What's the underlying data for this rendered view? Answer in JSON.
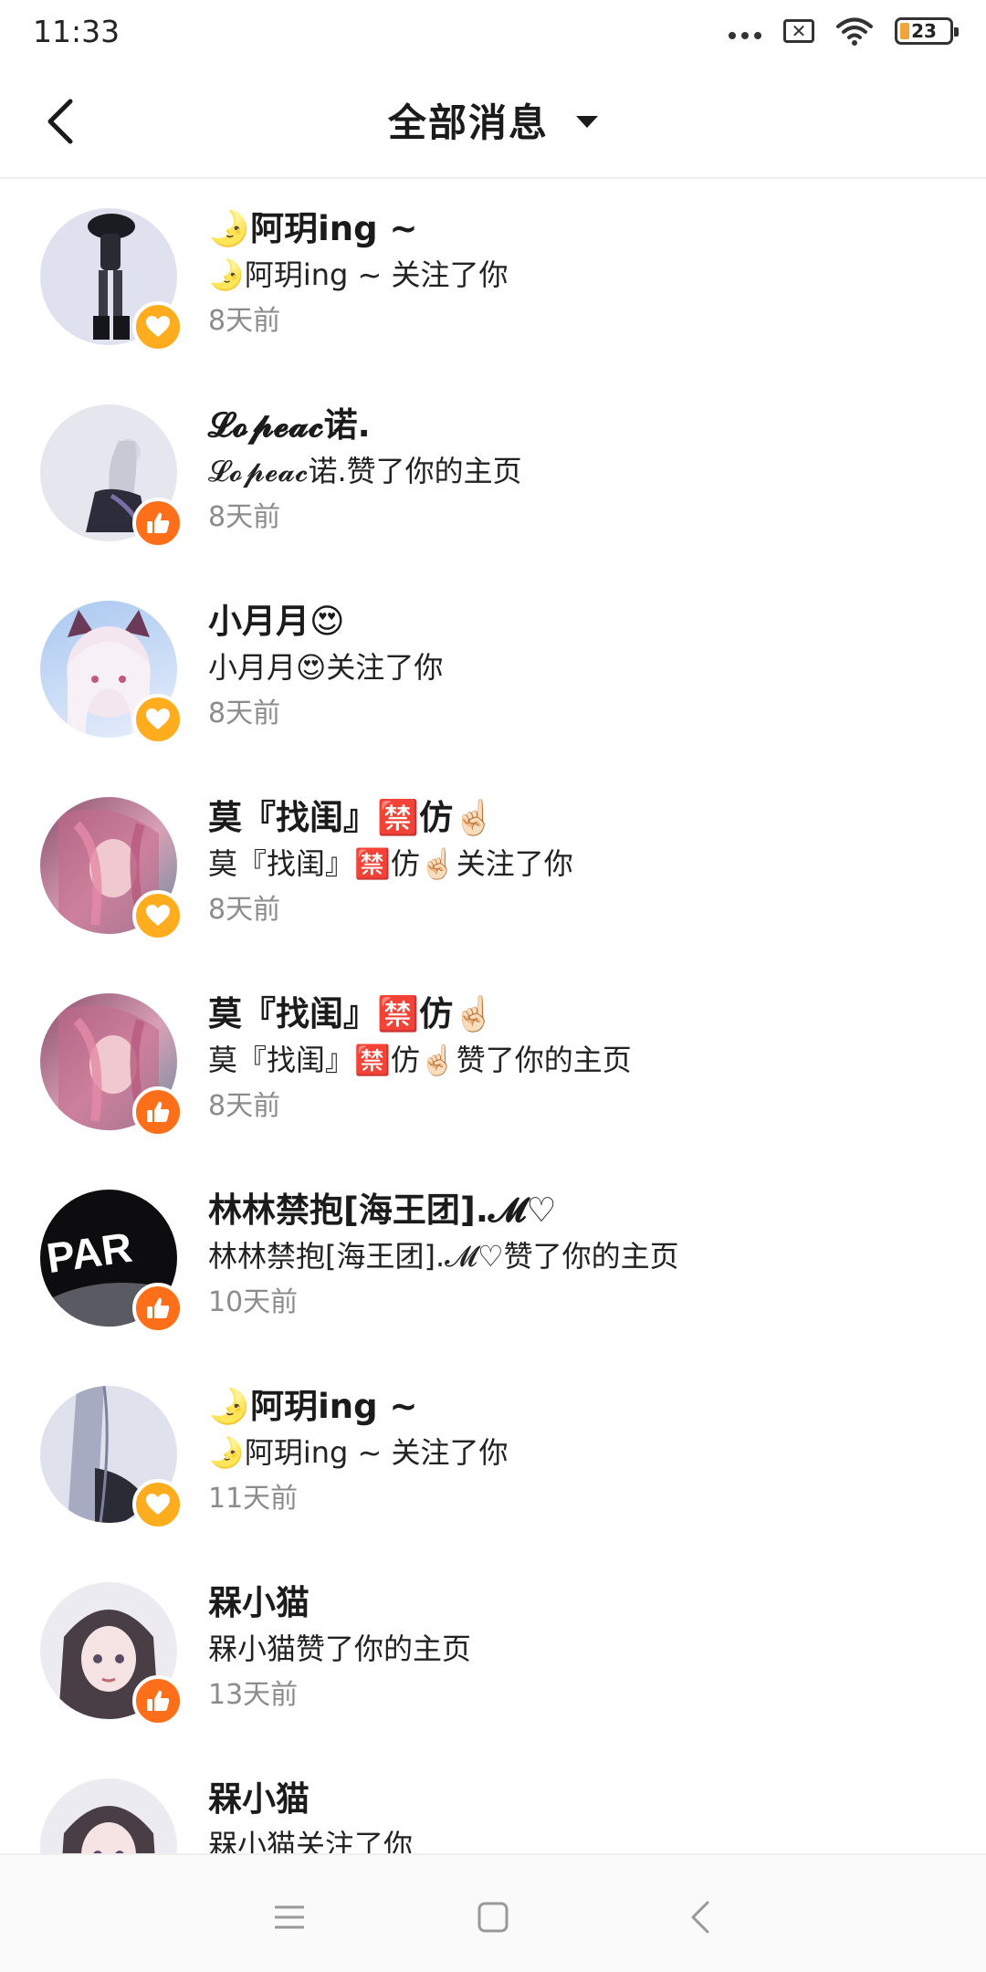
{
  "status_bar": {
    "time": "11:33",
    "battery_level": "23",
    "icons": [
      "more-dots-icon",
      "sim-off-icon",
      "wifi-icon",
      "battery-icon"
    ]
  },
  "header": {
    "title": "全部消息",
    "back_icon": "back-arrow-icon",
    "dropdown_icon": "caret-down-icon"
  },
  "notifications": [
    {
      "name": "🌛阿玥ing ~",
      "message": "🌛阿玥ing ~ 关注了你",
      "time": "8天前",
      "badge": "heart-icon"
    },
    {
      "name": "𝓛𝓸𝓹𝓮𝓪𝓬诺.",
      "message": "𝓛𝓸𝓹𝓮𝓪𝓬诺.赞了你的主页",
      "time": "8天前",
      "badge": "thumbs-up-icon"
    },
    {
      "name": "小月月😍",
      "message": "小月月😍关注了你",
      "time": "8天前",
      "badge": "heart-icon"
    },
    {
      "name": "莫『找闺』🈲仿☝🏻",
      "message": "莫『找闺』🈲仿☝🏻关注了你",
      "time": "8天前",
      "badge": "heart-icon"
    },
    {
      "name": "莫『找闺』🈲仿☝🏻",
      "message": "莫『找闺』🈲仿☝🏻赞了你的主页",
      "time": "8天前",
      "badge": "thumbs-up-icon"
    },
    {
      "name": "林林禁抱[海王团].𝓜♡",
      "message": "林林禁抱[海王团].𝓜♡赞了你的主页",
      "time": "10天前",
      "badge": "thumbs-up-icon"
    },
    {
      "name": "🌛阿玥ing ~",
      "message": "🌛阿玥ing ~ 关注了你",
      "time": "11天前",
      "badge": "heart-icon"
    },
    {
      "name": "槑小猫",
      "message": "槑小猫赞了你的主页",
      "time": "13天前",
      "badge": "thumbs-up-icon"
    },
    {
      "name": "槑小猫",
      "message": "槑小猫关注了你",
      "time": "",
      "badge": ""
    }
  ],
  "bottom_nav": {
    "icons": [
      "menu-icon",
      "home-square-icon",
      "back-chevron-icon"
    ]
  },
  "colors": {
    "heart_badge": "#ffad1f",
    "thumb_badge": "#ff6f19",
    "time_text": "#8c8c8c",
    "divider": "#eeeeee"
  }
}
